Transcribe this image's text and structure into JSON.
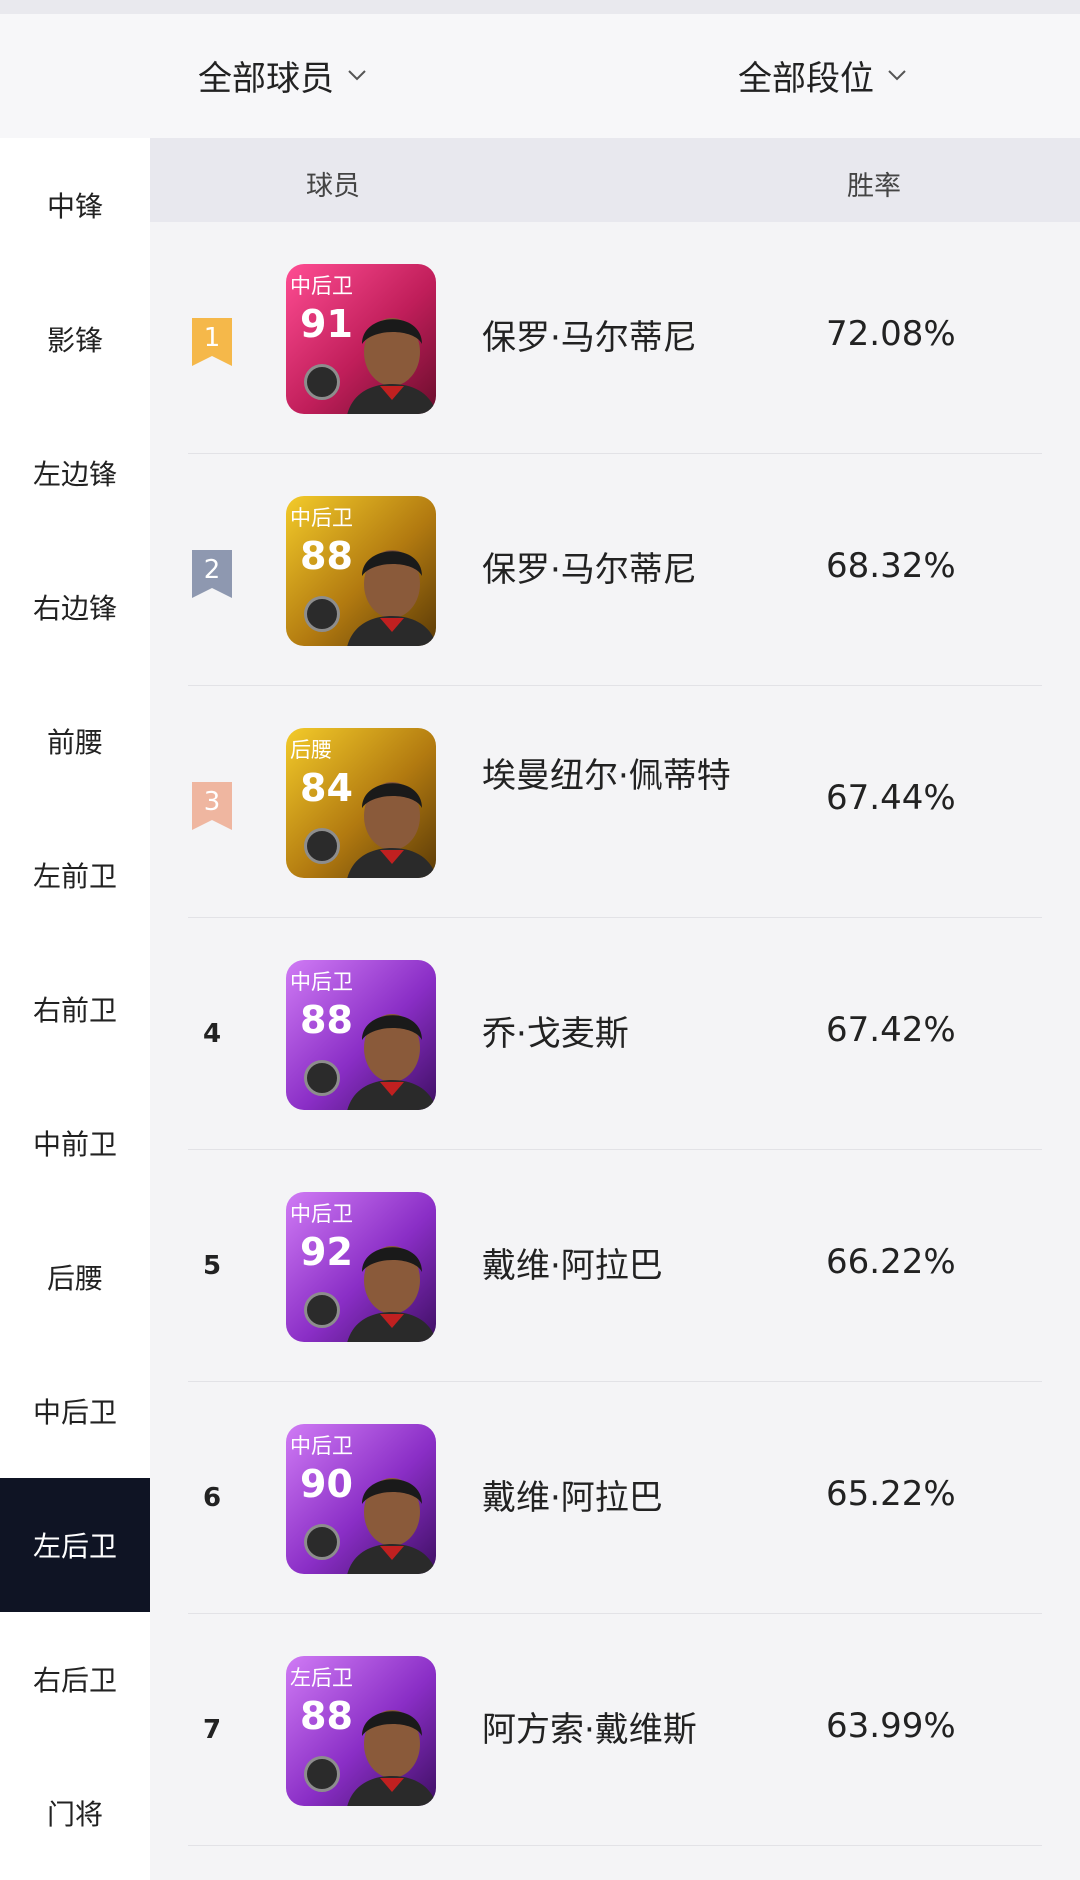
{
  "filters": {
    "players_label": "全部球员",
    "ranks_label": "全部段位"
  },
  "sidebar": {
    "items": [
      {
        "label": "中锋"
      },
      {
        "label": "影锋"
      },
      {
        "label": "左边锋"
      },
      {
        "label": "右边锋"
      },
      {
        "label": "前腰"
      },
      {
        "label": "左前卫"
      },
      {
        "label": "右前卫"
      },
      {
        "label": "中前卫"
      },
      {
        "label": "后腰"
      },
      {
        "label": "中后卫"
      },
      {
        "label": "左后卫",
        "active": true
      },
      {
        "label": "右后卫"
      },
      {
        "label": "门将"
      }
    ]
  },
  "table": {
    "headers": {
      "player": "球员",
      "win_rate": "胜率"
    },
    "rows": [
      {
        "rank": "1",
        "position": "中后卫",
        "rating": "91",
        "name": "保罗·马尔蒂尼",
        "win_rate": "72.08%",
        "card_color": "pink",
        "ribbon": "gold"
      },
      {
        "rank": "2",
        "position": "中后卫",
        "rating": "88",
        "name": "保罗·马尔蒂尼",
        "win_rate": "68.32%",
        "card_color": "gold",
        "ribbon": "silver"
      },
      {
        "rank": "3",
        "position": "后腰",
        "rating": "84",
        "name": "埃曼纽尔·佩蒂特",
        "win_rate": "67.44%",
        "card_color": "gold",
        "ribbon": "bronze"
      },
      {
        "rank": "4",
        "position": "中后卫",
        "rating": "88",
        "name": "乔·戈麦斯",
        "win_rate": "67.42%",
        "card_color": "purple",
        "ribbon": ""
      },
      {
        "rank": "5",
        "position": "中后卫",
        "rating": "92",
        "name": "戴维·阿拉巴",
        "win_rate": "66.22%",
        "card_color": "purple",
        "ribbon": ""
      },
      {
        "rank": "6",
        "position": "中后卫",
        "rating": "90",
        "name": "戴维·阿拉巴",
        "win_rate": "65.22%",
        "card_color": "purple",
        "ribbon": ""
      },
      {
        "rank": "7",
        "position": "左后卫",
        "rating": "88",
        "name": "阿方索·戴维斯",
        "win_rate": "63.99%",
        "card_color": "purple",
        "ribbon": ""
      }
    ]
  },
  "colors": {
    "ribbon_gold": "#f5b84a",
    "ribbon_silver": "#8e98b0",
    "ribbon_bronze": "#efb6a0",
    "card_pink": "#e0306f",
    "card_gold": "#d7a21a",
    "card_purple": "#9b3fd0",
    "active_bg": "#0f1424"
  }
}
